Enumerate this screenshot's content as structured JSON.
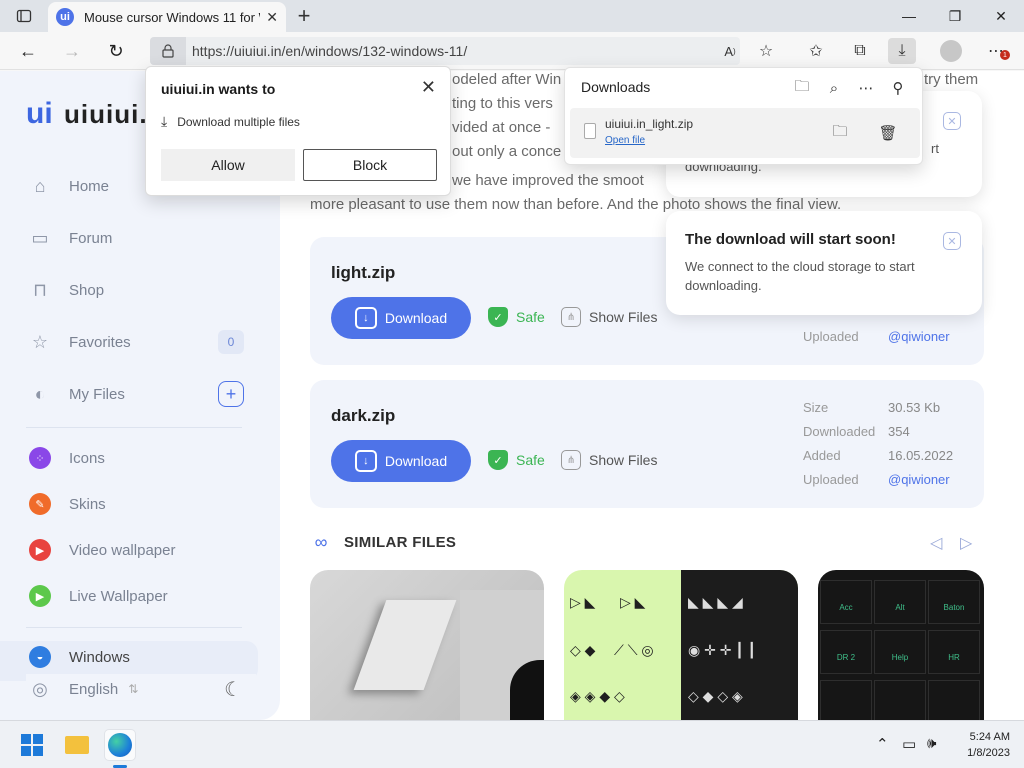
{
  "browser": {
    "tab_title": "Mouse cursor Windows 11 for W",
    "tab_favicon": "ui",
    "url": "https://uiuiui.in/en/windows/132-windows-11/"
  },
  "permission_popup": {
    "title": "uiuiui.in wants to",
    "description": "Download multiple files",
    "allow_label": "Allow",
    "block_label": "Block"
  },
  "downloads_panel": {
    "title": "Downloads",
    "file_name": "uiuiui.in_light.zip",
    "open_file_label": "Open file"
  },
  "sidebar": {
    "logo_mark": "ui",
    "logo_word": "uiuiui.",
    "nav": [
      {
        "label": "Home",
        "icon": "home-icon"
      },
      {
        "label": "Forum",
        "icon": "chat-icon"
      },
      {
        "label": "Shop",
        "icon": "cart-icon"
      },
      {
        "label": "Favorites",
        "icon": "star-icon",
        "count": "0"
      },
      {
        "label": "My Files",
        "icon": "files-icon"
      }
    ],
    "categories": [
      {
        "label": "Icons",
        "color": "#8a47e8"
      },
      {
        "label": "Skins",
        "color": "#f06b2a"
      },
      {
        "label": "Video wallpaper",
        "color": "#e8433f"
      },
      {
        "label": "Live Wallpaper",
        "color": "#5cc84b"
      },
      {
        "label": "Windows",
        "color": "#2f7de0"
      }
    ],
    "language": "English"
  },
  "article": {
    "lines": [
      "odeled after Win",
      "ting to this vers",
      "vided at once -",
      "out only a conce",
      "we have improved the smoot",
      "more pleasant to use them now than before. And the photo shows the final view."
    ],
    "right_fragment": "try them"
  },
  "toasts": [
    {
      "title": "The download will start soon!",
      "body": "We connect to the cloud storage to start downloading."
    }
  ],
  "toast_behind_fragment": "rt",
  "toast_behind_body": "downloading.",
  "files": [
    {
      "name": "light.zip",
      "download_label": "Download",
      "safe_label": "Safe",
      "show_files_label": "Show Files",
      "meta": [
        {
          "key": "Uploaded",
          "value": "@qiwioner"
        }
      ]
    },
    {
      "name": "dark.zip",
      "download_label": "Download",
      "safe_label": "Safe",
      "show_files_label": "Show Files",
      "meta": [
        {
          "key": "Size",
          "value": "30.53 Kb"
        },
        {
          "key": "Downloaded",
          "value": "354"
        },
        {
          "key": "Added",
          "value": "16.05.2022"
        },
        {
          "key": "Uploaded",
          "value": "@qiwioner"
        }
      ]
    }
  ],
  "similar": {
    "title": "SIMILAR FILES"
  },
  "thumb_labels": [
    "Acc",
    "Alt",
    "Baton",
    "DR 2",
    "Help",
    "HR"
  ],
  "taskbar": {
    "time": "5:24 AM",
    "date": "1/8/2023",
    "notification_count": "1"
  }
}
